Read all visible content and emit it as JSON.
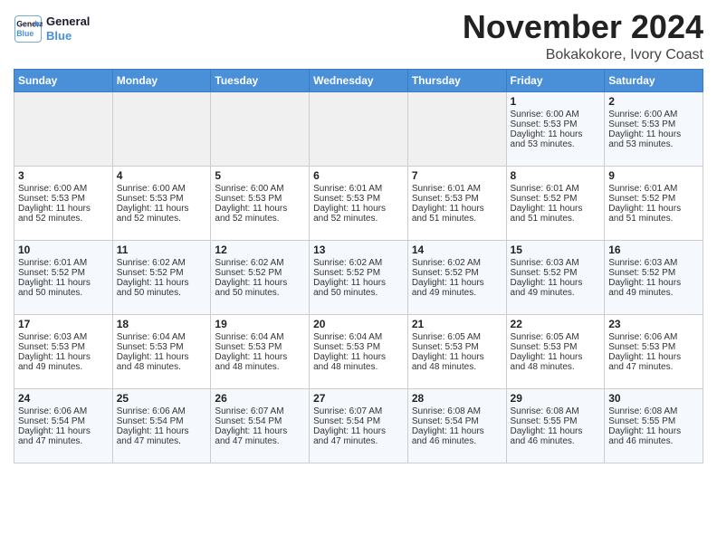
{
  "header": {
    "logo_line1": "General",
    "logo_line2": "Blue",
    "month": "November 2024",
    "location": "Bokakokore, Ivory Coast"
  },
  "weekdays": [
    "Sunday",
    "Monday",
    "Tuesday",
    "Wednesday",
    "Thursday",
    "Friday",
    "Saturday"
  ],
  "weeks": [
    [
      {
        "day": "",
        "info": ""
      },
      {
        "day": "",
        "info": ""
      },
      {
        "day": "",
        "info": ""
      },
      {
        "day": "",
        "info": ""
      },
      {
        "day": "",
        "info": ""
      },
      {
        "day": "1",
        "info": "Sunrise: 6:00 AM\nSunset: 5:53 PM\nDaylight: 11 hours\nand 53 minutes."
      },
      {
        "day": "2",
        "info": "Sunrise: 6:00 AM\nSunset: 5:53 PM\nDaylight: 11 hours\nand 53 minutes."
      }
    ],
    [
      {
        "day": "3",
        "info": "Sunrise: 6:00 AM\nSunset: 5:53 PM\nDaylight: 11 hours\nand 52 minutes."
      },
      {
        "day": "4",
        "info": "Sunrise: 6:00 AM\nSunset: 5:53 PM\nDaylight: 11 hours\nand 52 minutes."
      },
      {
        "day": "5",
        "info": "Sunrise: 6:00 AM\nSunset: 5:53 PM\nDaylight: 11 hours\nand 52 minutes."
      },
      {
        "day": "6",
        "info": "Sunrise: 6:01 AM\nSunset: 5:53 PM\nDaylight: 11 hours\nand 52 minutes."
      },
      {
        "day": "7",
        "info": "Sunrise: 6:01 AM\nSunset: 5:53 PM\nDaylight: 11 hours\nand 51 minutes."
      },
      {
        "day": "8",
        "info": "Sunrise: 6:01 AM\nSunset: 5:52 PM\nDaylight: 11 hours\nand 51 minutes."
      },
      {
        "day": "9",
        "info": "Sunrise: 6:01 AM\nSunset: 5:52 PM\nDaylight: 11 hours\nand 51 minutes."
      }
    ],
    [
      {
        "day": "10",
        "info": "Sunrise: 6:01 AM\nSunset: 5:52 PM\nDaylight: 11 hours\nand 50 minutes."
      },
      {
        "day": "11",
        "info": "Sunrise: 6:02 AM\nSunset: 5:52 PM\nDaylight: 11 hours\nand 50 minutes."
      },
      {
        "day": "12",
        "info": "Sunrise: 6:02 AM\nSunset: 5:52 PM\nDaylight: 11 hours\nand 50 minutes."
      },
      {
        "day": "13",
        "info": "Sunrise: 6:02 AM\nSunset: 5:52 PM\nDaylight: 11 hours\nand 50 minutes."
      },
      {
        "day": "14",
        "info": "Sunrise: 6:02 AM\nSunset: 5:52 PM\nDaylight: 11 hours\nand 49 minutes."
      },
      {
        "day": "15",
        "info": "Sunrise: 6:03 AM\nSunset: 5:52 PM\nDaylight: 11 hours\nand 49 minutes."
      },
      {
        "day": "16",
        "info": "Sunrise: 6:03 AM\nSunset: 5:52 PM\nDaylight: 11 hours\nand 49 minutes."
      }
    ],
    [
      {
        "day": "17",
        "info": "Sunrise: 6:03 AM\nSunset: 5:53 PM\nDaylight: 11 hours\nand 49 minutes."
      },
      {
        "day": "18",
        "info": "Sunrise: 6:04 AM\nSunset: 5:53 PM\nDaylight: 11 hours\nand 48 minutes."
      },
      {
        "day": "19",
        "info": "Sunrise: 6:04 AM\nSunset: 5:53 PM\nDaylight: 11 hours\nand 48 minutes."
      },
      {
        "day": "20",
        "info": "Sunrise: 6:04 AM\nSunset: 5:53 PM\nDaylight: 11 hours\nand 48 minutes."
      },
      {
        "day": "21",
        "info": "Sunrise: 6:05 AM\nSunset: 5:53 PM\nDaylight: 11 hours\nand 48 minutes."
      },
      {
        "day": "22",
        "info": "Sunrise: 6:05 AM\nSunset: 5:53 PM\nDaylight: 11 hours\nand 48 minutes."
      },
      {
        "day": "23",
        "info": "Sunrise: 6:06 AM\nSunset: 5:53 PM\nDaylight: 11 hours\nand 47 minutes."
      }
    ],
    [
      {
        "day": "24",
        "info": "Sunrise: 6:06 AM\nSunset: 5:54 PM\nDaylight: 11 hours\nand 47 minutes."
      },
      {
        "day": "25",
        "info": "Sunrise: 6:06 AM\nSunset: 5:54 PM\nDaylight: 11 hours\nand 47 minutes."
      },
      {
        "day": "26",
        "info": "Sunrise: 6:07 AM\nSunset: 5:54 PM\nDaylight: 11 hours\nand 47 minutes."
      },
      {
        "day": "27",
        "info": "Sunrise: 6:07 AM\nSunset: 5:54 PM\nDaylight: 11 hours\nand 47 minutes."
      },
      {
        "day": "28",
        "info": "Sunrise: 6:08 AM\nSunset: 5:54 PM\nDaylight: 11 hours\nand 46 minutes."
      },
      {
        "day": "29",
        "info": "Sunrise: 6:08 AM\nSunset: 5:55 PM\nDaylight: 11 hours\nand 46 minutes."
      },
      {
        "day": "30",
        "info": "Sunrise: 6:08 AM\nSunset: 5:55 PM\nDaylight: 11 hours\nand 46 minutes."
      }
    ]
  ]
}
